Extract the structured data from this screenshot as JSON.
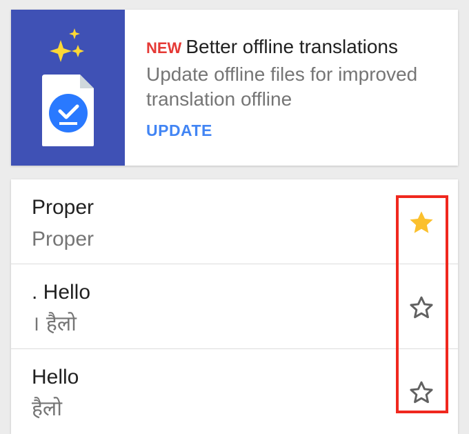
{
  "promo": {
    "badge": "NEW",
    "title": "Better offline translations",
    "description": "Update offline files for improved translation offline",
    "action_label": "UPDATE",
    "art_background": "#3f51b5",
    "icon": "document-check-icon"
  },
  "phrasebook": {
    "items": [
      {
        "source": "Proper",
        "translation": "Proper",
        "starred": true
      },
      {
        "source": ". Hello",
        "translation": "। हैलो",
        "starred": false
      },
      {
        "source": "Hello",
        "translation": "हैलो",
        "starred": false
      }
    ]
  },
  "colors": {
    "accent_blue": "#4285f4",
    "badge_red": "#e53935",
    "star_filled": "#fbc02d",
    "star_outline": "#616161",
    "highlight": "#f0281e"
  }
}
